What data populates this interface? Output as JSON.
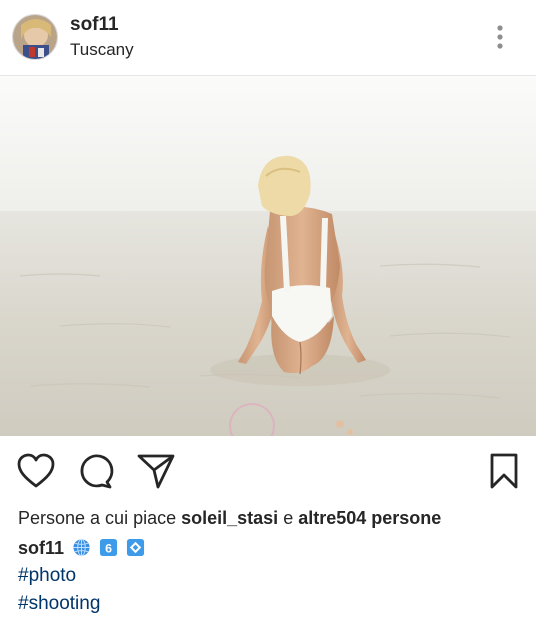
{
  "post": {
    "username": "sof11",
    "location": "Tuscany"
  },
  "icons": {
    "avatar": "profile-photo",
    "more": "vertical-ellipsis-icon",
    "like": "heart-icon",
    "comment": "speech-bubble-icon",
    "share": "paper-plane-icon",
    "save": "bookmark-icon",
    "caption_emojis": [
      "globe-emoji",
      "number-six-emoji",
      "blue-diamond-emoji"
    ]
  },
  "likes": {
    "prefix": "Persone a cui piace",
    "user": "soleil_stasi",
    "conjunction": "e",
    "others": "altre504 persone"
  },
  "caption": {
    "user": "sof11",
    "emoji_six": "6"
  },
  "hashtags": [
    "#photo",
    "#shooting"
  ],
  "colors": {
    "text": "#262626",
    "hashtag": "#003569",
    "divider": "#e6e6e6"
  }
}
